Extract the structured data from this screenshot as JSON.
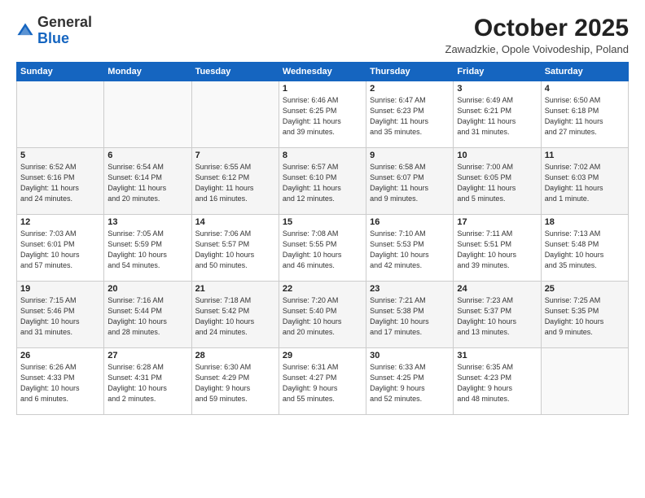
{
  "header": {
    "logo_general": "General",
    "logo_blue": "Blue",
    "month": "October 2025",
    "location": "Zawadzkie, Opole Voivodeship, Poland"
  },
  "weekdays": [
    "Sunday",
    "Monday",
    "Tuesday",
    "Wednesday",
    "Thursday",
    "Friday",
    "Saturday"
  ],
  "weeks": [
    [
      {
        "day": "",
        "info": ""
      },
      {
        "day": "",
        "info": ""
      },
      {
        "day": "",
        "info": ""
      },
      {
        "day": "1",
        "info": "Sunrise: 6:46 AM\nSunset: 6:25 PM\nDaylight: 11 hours\nand 39 minutes."
      },
      {
        "day": "2",
        "info": "Sunrise: 6:47 AM\nSunset: 6:23 PM\nDaylight: 11 hours\nand 35 minutes."
      },
      {
        "day": "3",
        "info": "Sunrise: 6:49 AM\nSunset: 6:21 PM\nDaylight: 11 hours\nand 31 minutes."
      },
      {
        "day": "4",
        "info": "Sunrise: 6:50 AM\nSunset: 6:18 PM\nDaylight: 11 hours\nand 27 minutes."
      }
    ],
    [
      {
        "day": "5",
        "info": "Sunrise: 6:52 AM\nSunset: 6:16 PM\nDaylight: 11 hours\nand 24 minutes."
      },
      {
        "day": "6",
        "info": "Sunrise: 6:54 AM\nSunset: 6:14 PM\nDaylight: 11 hours\nand 20 minutes."
      },
      {
        "day": "7",
        "info": "Sunrise: 6:55 AM\nSunset: 6:12 PM\nDaylight: 11 hours\nand 16 minutes."
      },
      {
        "day": "8",
        "info": "Sunrise: 6:57 AM\nSunset: 6:10 PM\nDaylight: 11 hours\nand 12 minutes."
      },
      {
        "day": "9",
        "info": "Sunrise: 6:58 AM\nSunset: 6:07 PM\nDaylight: 11 hours\nand 9 minutes."
      },
      {
        "day": "10",
        "info": "Sunrise: 7:00 AM\nSunset: 6:05 PM\nDaylight: 11 hours\nand 5 minutes."
      },
      {
        "day": "11",
        "info": "Sunrise: 7:02 AM\nSunset: 6:03 PM\nDaylight: 11 hours\nand 1 minute."
      }
    ],
    [
      {
        "day": "12",
        "info": "Sunrise: 7:03 AM\nSunset: 6:01 PM\nDaylight: 10 hours\nand 57 minutes."
      },
      {
        "day": "13",
        "info": "Sunrise: 7:05 AM\nSunset: 5:59 PM\nDaylight: 10 hours\nand 54 minutes."
      },
      {
        "day": "14",
        "info": "Sunrise: 7:06 AM\nSunset: 5:57 PM\nDaylight: 10 hours\nand 50 minutes."
      },
      {
        "day": "15",
        "info": "Sunrise: 7:08 AM\nSunset: 5:55 PM\nDaylight: 10 hours\nand 46 minutes."
      },
      {
        "day": "16",
        "info": "Sunrise: 7:10 AM\nSunset: 5:53 PM\nDaylight: 10 hours\nand 42 minutes."
      },
      {
        "day": "17",
        "info": "Sunrise: 7:11 AM\nSunset: 5:51 PM\nDaylight: 10 hours\nand 39 minutes."
      },
      {
        "day": "18",
        "info": "Sunrise: 7:13 AM\nSunset: 5:48 PM\nDaylight: 10 hours\nand 35 minutes."
      }
    ],
    [
      {
        "day": "19",
        "info": "Sunrise: 7:15 AM\nSunset: 5:46 PM\nDaylight: 10 hours\nand 31 minutes."
      },
      {
        "day": "20",
        "info": "Sunrise: 7:16 AM\nSunset: 5:44 PM\nDaylight: 10 hours\nand 28 minutes."
      },
      {
        "day": "21",
        "info": "Sunrise: 7:18 AM\nSunset: 5:42 PM\nDaylight: 10 hours\nand 24 minutes."
      },
      {
        "day": "22",
        "info": "Sunrise: 7:20 AM\nSunset: 5:40 PM\nDaylight: 10 hours\nand 20 minutes."
      },
      {
        "day": "23",
        "info": "Sunrise: 7:21 AM\nSunset: 5:38 PM\nDaylight: 10 hours\nand 17 minutes."
      },
      {
        "day": "24",
        "info": "Sunrise: 7:23 AM\nSunset: 5:37 PM\nDaylight: 10 hours\nand 13 minutes."
      },
      {
        "day": "25",
        "info": "Sunrise: 7:25 AM\nSunset: 5:35 PM\nDaylight: 10 hours\nand 9 minutes."
      }
    ],
    [
      {
        "day": "26",
        "info": "Sunrise: 6:26 AM\nSunset: 4:33 PM\nDaylight: 10 hours\nand 6 minutes."
      },
      {
        "day": "27",
        "info": "Sunrise: 6:28 AM\nSunset: 4:31 PM\nDaylight: 10 hours\nand 2 minutes."
      },
      {
        "day": "28",
        "info": "Sunrise: 6:30 AM\nSunset: 4:29 PM\nDaylight: 9 hours\nand 59 minutes."
      },
      {
        "day": "29",
        "info": "Sunrise: 6:31 AM\nSunset: 4:27 PM\nDaylight: 9 hours\nand 55 minutes."
      },
      {
        "day": "30",
        "info": "Sunrise: 6:33 AM\nSunset: 4:25 PM\nDaylight: 9 hours\nand 52 minutes."
      },
      {
        "day": "31",
        "info": "Sunrise: 6:35 AM\nSunset: 4:23 PM\nDaylight: 9 hours\nand 48 minutes."
      },
      {
        "day": "",
        "info": ""
      }
    ]
  ]
}
